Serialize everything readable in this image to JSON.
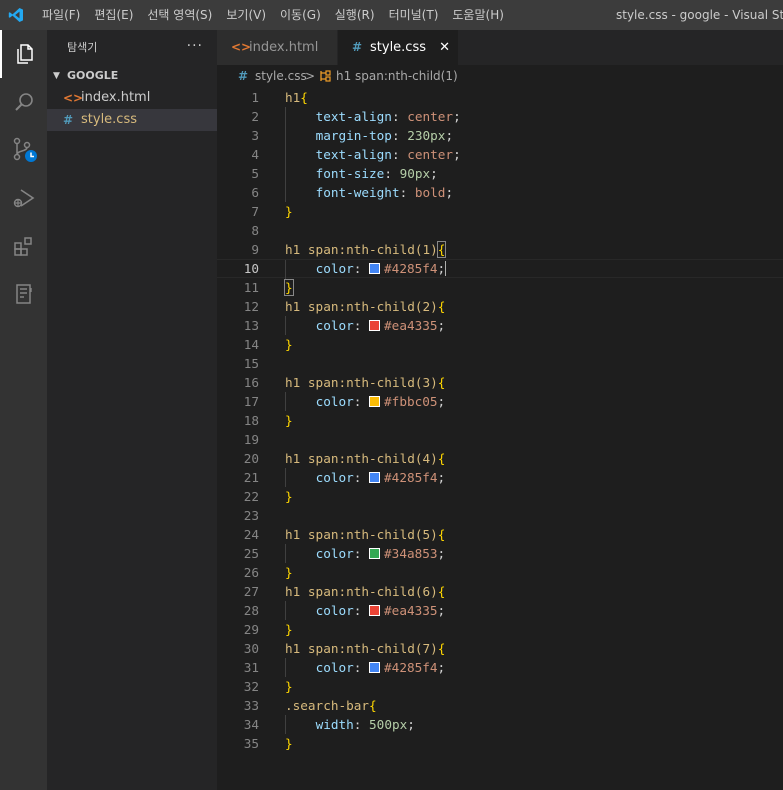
{
  "menu": [
    "파일(F)",
    "편집(E)",
    "선택 영역(S)",
    "보기(V)",
    "이동(G)",
    "실행(R)",
    "터미널(T)",
    "도움말(H)"
  ],
  "window_title": "style.css - google - Visual Studio",
  "activity_bar": [
    "explorer-icon",
    "search-icon",
    "source-control-icon",
    "run-debug-icon",
    "extensions-icon",
    "notebook-icon"
  ],
  "sidebar": {
    "title": "탐색기",
    "more": "···",
    "section": "GOOGLE",
    "files": [
      {
        "icon": "<>",
        "name": "index.html",
        "icon_color": "#e37933"
      },
      {
        "icon": "#",
        "name": "style.css",
        "icon_color": "#519aba"
      }
    ]
  },
  "tabs": [
    {
      "icon": "<>",
      "name": "index.html",
      "icon_color": "#e37933"
    },
    {
      "icon": "#",
      "name": "style.css",
      "icon_color": "#519aba",
      "close": "✕"
    }
  ],
  "breadcrumb": {
    "file_icon": "#",
    "file": "style.css",
    "sep": ">",
    "symbol": "h1 span:nth-child(1)"
  },
  "current_line": 10,
  "editor_lines": [
    {
      "n": "1",
      "t": "h1{"
    },
    {
      "n": "2",
      "t": "    text-align: center;"
    },
    {
      "n": "3",
      "t": "    margin-top: 230px;"
    },
    {
      "n": "4",
      "t": "    text-align: center;"
    },
    {
      "n": "5",
      "t": "    font-size: 90px;"
    },
    {
      "n": "6",
      "t": "    font-weight: bold;"
    },
    {
      "n": "7",
      "t": "}"
    },
    {
      "n": "8",
      "t": ""
    },
    {
      "n": "9",
      "t": "h1 span:nth-child(1){"
    },
    {
      "n": "10",
      "t": "    color: #4285f4;"
    },
    {
      "n": "11",
      "t": "}"
    },
    {
      "n": "12",
      "t": "h1 span:nth-child(2){"
    },
    {
      "n": "13",
      "t": "    color: #ea4335;"
    },
    {
      "n": "14",
      "t": "}"
    },
    {
      "n": "15",
      "t": ""
    },
    {
      "n": "16",
      "t": "h1 span:nth-child(3){"
    },
    {
      "n": "17",
      "t": "    color: #fbbc05;"
    },
    {
      "n": "18",
      "t": "}"
    },
    {
      "n": "19",
      "t": ""
    },
    {
      "n": "20",
      "t": "h1 span:nth-child(4){"
    },
    {
      "n": "21",
      "t": "    color: #4285f4;"
    },
    {
      "n": "22",
      "t": "}"
    },
    {
      "n": "23",
      "t": ""
    },
    {
      "n": "24",
      "t": "h1 span:nth-child(5){"
    },
    {
      "n": "25",
      "t": "    color: #34a853;"
    },
    {
      "n": "26",
      "t": "}"
    },
    {
      "n": "27",
      "t": "h1 span:nth-child(6){"
    },
    {
      "n": "28",
      "t": "    color: #ea4335;"
    },
    {
      "n": "29",
      "t": "}"
    },
    {
      "n": "30",
      "t": "h1 span:nth-child(7){"
    },
    {
      "n": "31",
      "t": "    color: #4285f4;"
    },
    {
      "n": "32",
      "t": "}"
    },
    {
      "n": "33",
      "t": ".search-bar{"
    },
    {
      "n": "34",
      "t": "    width: 500px;"
    },
    {
      "n": "35",
      "t": "}"
    }
  ]
}
